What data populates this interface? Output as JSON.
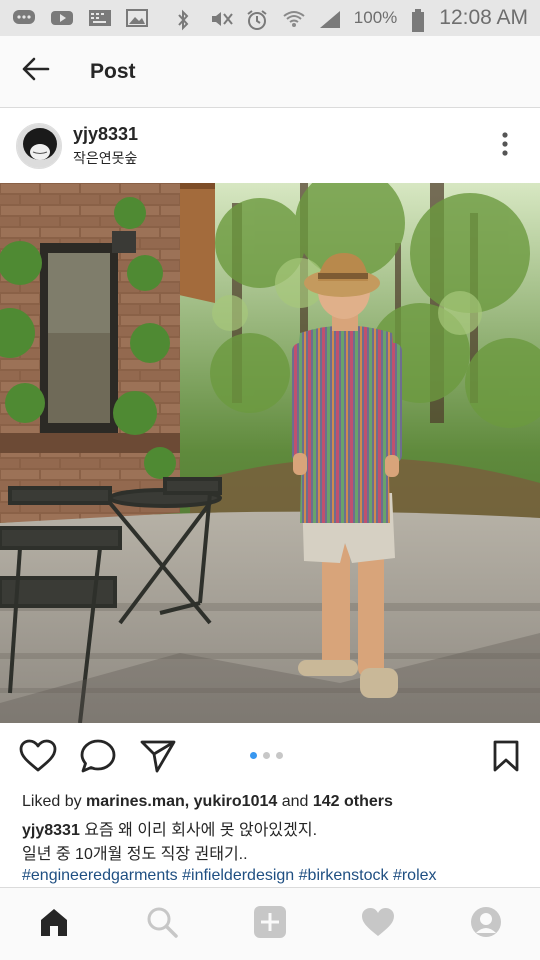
{
  "status_bar": {
    "battery_percent": "100%",
    "time": "12:08 AM",
    "icons_left": [
      "messages-icon",
      "youtube-icon",
      "keyboard-icon",
      "gallery-icon"
    ],
    "icons_right": [
      "bluetooth-icon",
      "mute-icon",
      "alarm-icon",
      "wifi-icon",
      "signal-icon",
      "battery-icon"
    ]
  },
  "app_bar": {
    "title": "Post"
  },
  "post": {
    "username": "yjy8331",
    "location": "작은연못숲",
    "carousel": {
      "count": 3,
      "active_index": 0
    },
    "liked_by_prefix": "Liked by ",
    "liked_by_users": "marines.man, yukiro1014",
    "liked_by_and": " and ",
    "liked_by_others": "142 others",
    "caption_user": "yjy8331",
    "caption_line1": " 요즘 왜 이리 회사에 못 앉아있겠지.",
    "caption_line2": "일년 중 10개월 정도 직장 권태기..",
    "hashtags": [
      "#engineeredgarments",
      "#infielderdesign",
      "#birkenstock",
      "#rolex"
    ]
  },
  "bottom_nav": [
    "home-icon",
    "search-icon",
    "add-post-icon",
    "activity-heart-icon",
    "profile-icon"
  ],
  "colors": {
    "link": "#1f4f82",
    "carousel_active": "#3897f0",
    "text": "#262626"
  }
}
